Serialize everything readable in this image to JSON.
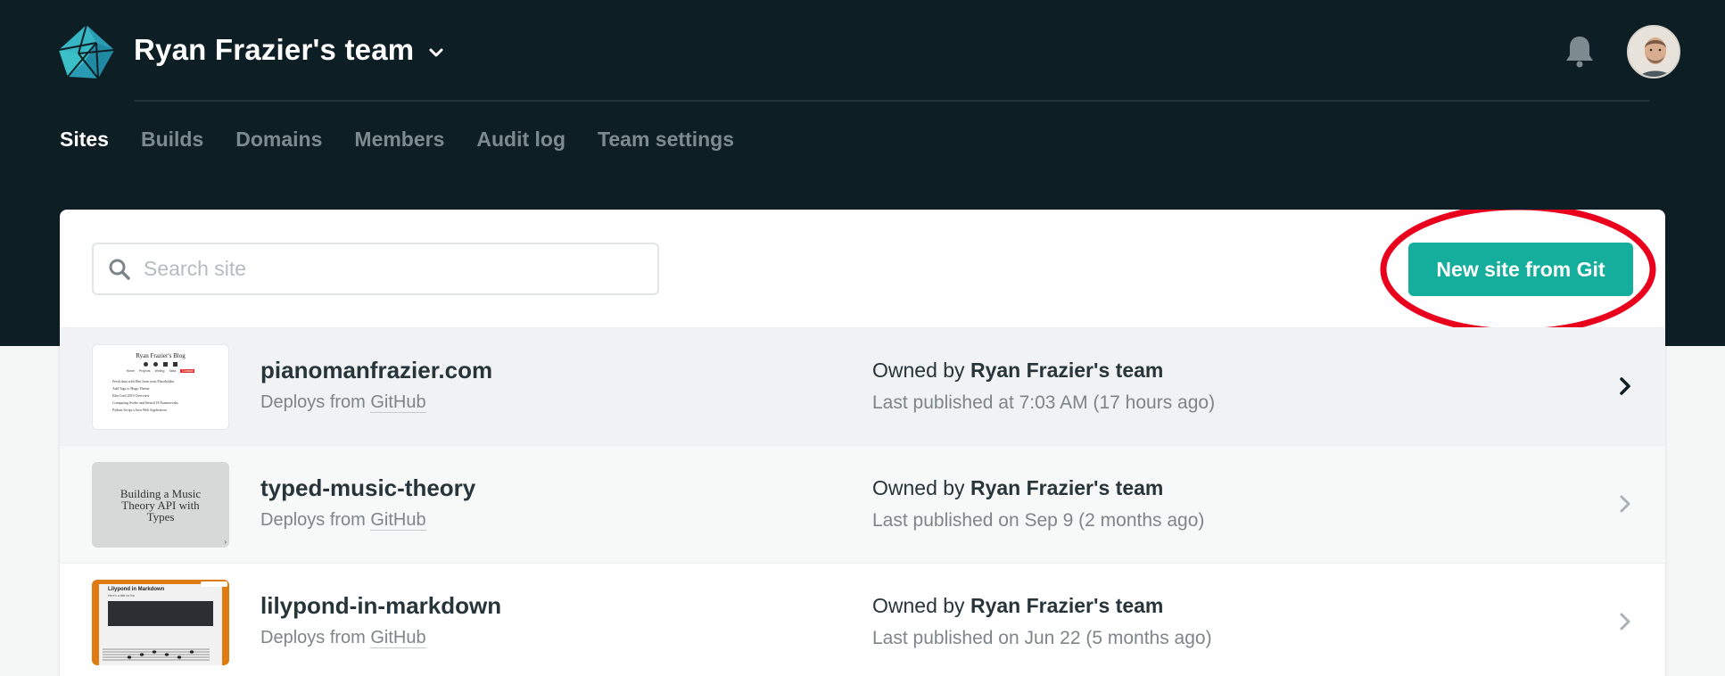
{
  "header": {
    "team_name": "Ryan Frazier's team"
  },
  "nav": {
    "tabs": [
      {
        "label": "Sites",
        "active": true
      },
      {
        "label": "Builds"
      },
      {
        "label": "Domains"
      },
      {
        "label": "Members"
      },
      {
        "label": "Audit log"
      },
      {
        "label": "Team settings"
      }
    ]
  },
  "search": {
    "placeholder": "Search site",
    "value": ""
  },
  "new_site_button": {
    "label": "New site from Git",
    "color": "#15ad9b",
    "highlight_color": "#e8001c"
  },
  "sites": [
    {
      "name": "pianomanfrazier.com",
      "deploys_prefix": "Deploys from ",
      "deploys_source": "GitHub",
      "owner_prefix": "Owned by ",
      "owner": "Ryan Frazier's team",
      "published": "Last published at 7:03 AM (17 hours ago)",
      "thumbnail": {
        "title": "Ryan Frazier's Blog",
        "nav": [
          "Home",
          "Projects",
          "Writing",
          "Talks",
          "Contact"
        ],
        "posts": [
          "Fresh data with Elm from your Placeholder",
          "Add Tags to Hugo Theme",
          "Elm Conf 2019 Overview",
          "Comparing Svelte and Stencil JS Frameworks",
          "Python Script a Java Web Application"
        ]
      }
    },
    {
      "name": "typed-music-theory",
      "deploys_prefix": "Deploys from ",
      "deploys_source": "GitHub",
      "owner_prefix": "Owned by ",
      "owner": "Ryan Frazier's team",
      "published": "Last published on Sep 9 (2 months ago)",
      "thumbnail": {
        "text": "Building a Music Theory API with Types"
      }
    },
    {
      "name": "lilypond-in-markdown",
      "deploys_prefix": "Deploys from ",
      "deploys_source": "GitHub",
      "owner_prefix": "Owned by ",
      "owner": "Ryan Frazier's team",
      "published": "Last published on Jun 22 (5 months ago)",
      "thumbnail": {
        "title": "Lilypond in Markdown",
        "subtitle": "Here's a title for the"
      }
    }
  ],
  "colors": {
    "header_bg": "#0e1e25",
    "accent": "#15ad9b",
    "thumb_orange": "#e07b12"
  }
}
